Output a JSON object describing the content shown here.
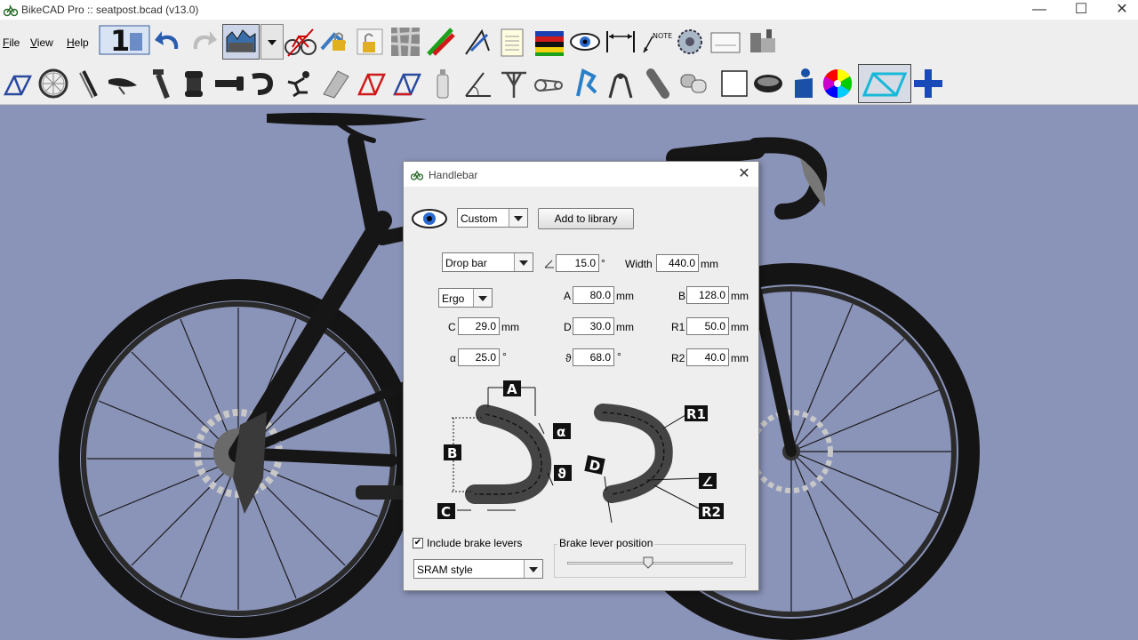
{
  "window": {
    "title": "BikeCAD Pro :: seatpost.bcad (v13.0)",
    "minimize": "—",
    "maximize": "☐",
    "close": "✕"
  },
  "menu": {
    "items": [
      {
        "label": "File",
        "accel": "F",
        "rest": "ile"
      },
      {
        "label": "View",
        "accel": "V",
        "rest": "iew"
      },
      {
        "label": "Help",
        "accel": "H",
        "rest": "elp"
      }
    ]
  },
  "toolbar_top": [
    "version-one-icon",
    "undo-icon",
    "redo-icon",
    "terrain-icon",
    "dropdown-icon",
    "bike-dimension-icon",
    "lock-icon",
    "unlock-icon",
    "texture-icon",
    "frame-angle-icon",
    "geometry-tool-icon",
    "notepad-icon",
    "flag-icon",
    "eye-icon",
    "dimension-arrows-icon",
    "note-icon",
    "chainring-icon",
    "paper-icon",
    "fixture-icon"
  ],
  "toolbar_bottom": [
    "frame-icon",
    "wheel-icon",
    "fork-icon",
    "saddle-icon",
    "seatpost-icon",
    "headset-icon",
    "stem-icon",
    "handlebar-icon",
    "rider-icon",
    "tube-icon",
    "frame-red-icon",
    "frame-blue-icon",
    "bottle-icon",
    "angle-icon",
    "seat-lug-icon",
    "drivetrain-icon",
    "brake-caliper-icon",
    "rim-brake-icon",
    "cable-icon",
    "chain-link-icon",
    "blank-box-icon",
    "tire-icon",
    "rider-figure-icon",
    "color-wheel-icon",
    "frame-cyan-icon",
    "add-icon"
  ],
  "dialog": {
    "title": "Handlebar",
    "preset": "Custom",
    "add_to_library": "Add to library",
    "bar_type": "Drop bar",
    "bend_type": "Ergo",
    "angle_value": "15.0",
    "angle_unit": "°",
    "width_label": "Width",
    "width_value": "440.0",
    "mm": "mm",
    "deg": "°",
    "A_label": "A",
    "A_value": "80.0",
    "B_label": "B",
    "B_value": "128.0",
    "C_label": "C",
    "C_value": "29.0",
    "D_label": "D",
    "D_value": "30.0",
    "R1_label": "R1",
    "R1_value": "50.0",
    "alpha_label": "α",
    "alpha_value": "25.0",
    "theta_label": "ϑ",
    "theta_value": "68.0",
    "R2_label": "R2",
    "R2_value": "40.0",
    "diagram_labels": {
      "A": "A",
      "B": "B",
      "C": "C",
      "D": "D",
      "alpha": "α",
      "theta": "ϑ",
      "R1": "R1",
      "R2": "R2",
      "angle": "∠"
    },
    "include_brake_levers": "Include brake levers",
    "include_checked": true,
    "brake_style": "SRAM style",
    "brake_position_title": "Brake lever position",
    "brake_position_fraction": 0.49
  },
  "colors": {
    "canvas_bg": "#8a93b8",
    "frame": "#1a1a1a",
    "tire": "#151515"
  }
}
